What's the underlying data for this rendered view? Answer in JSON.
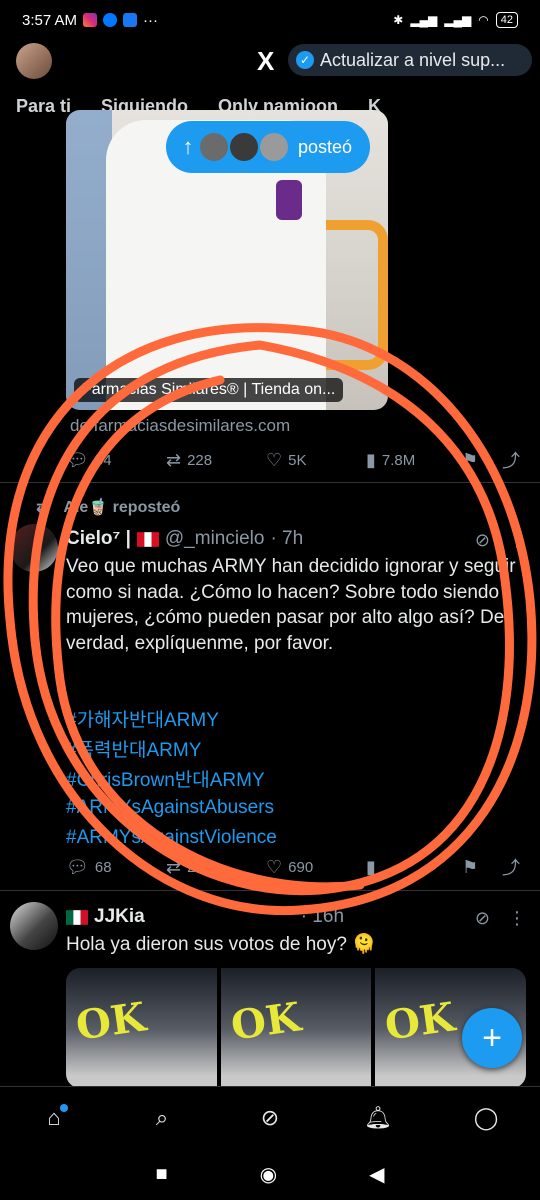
{
  "status_bar": {
    "time": "3:57 AM",
    "battery": "42"
  },
  "top_bar": {
    "logo": "X",
    "upgrade_label": "Actualizar a nivel sup..."
  },
  "tabs": [
    "Para ti",
    "Siguiendo",
    "Only namjoon",
    "K"
  ],
  "posted_pill": {
    "label": "posteó"
  },
  "link_card": {
    "title": "Farmacias Similares® | Tienda on...",
    "domain": "de farmaciasdesimilares.com"
  },
  "tweet1_actions": {
    "replies": "54",
    "reposts": "228",
    "likes": "5K",
    "views": "7.8M"
  },
  "repost_banner": {
    "text": "Ale🧋 reposteó"
  },
  "tweet2": {
    "name": "Cielo⁷ |",
    "handle": "@_mincielo",
    "time": "· 7h",
    "text": "Veo que muchas ARMY han decidido ignorar y seguir como si nada. ¿Cómo lo hacen? Sobre todo siendo mujeres, ¿cómo pueden pasar por alto algo así? De verdad, explíquenme, por favor.",
    "hashtags": [
      "#가해자반대ARMY",
      "#폭력반대ARMY",
      "#ChrisBrown반대ARMY",
      "#ARMYsAgainstAbusers",
      "#ARMYsAgainstViolence"
    ],
    "actions": {
      "replies": "68",
      "reposts": "210",
      "likes": "690"
    }
  },
  "tweet3": {
    "name": "JJKia",
    "time": "· 16h",
    "text": "Hola ya dieron sus votos de hoy? 🫠"
  },
  "colors": {
    "accent": "#1d9bf0",
    "annotation": "#ff6a3d",
    "background": "#000000"
  }
}
